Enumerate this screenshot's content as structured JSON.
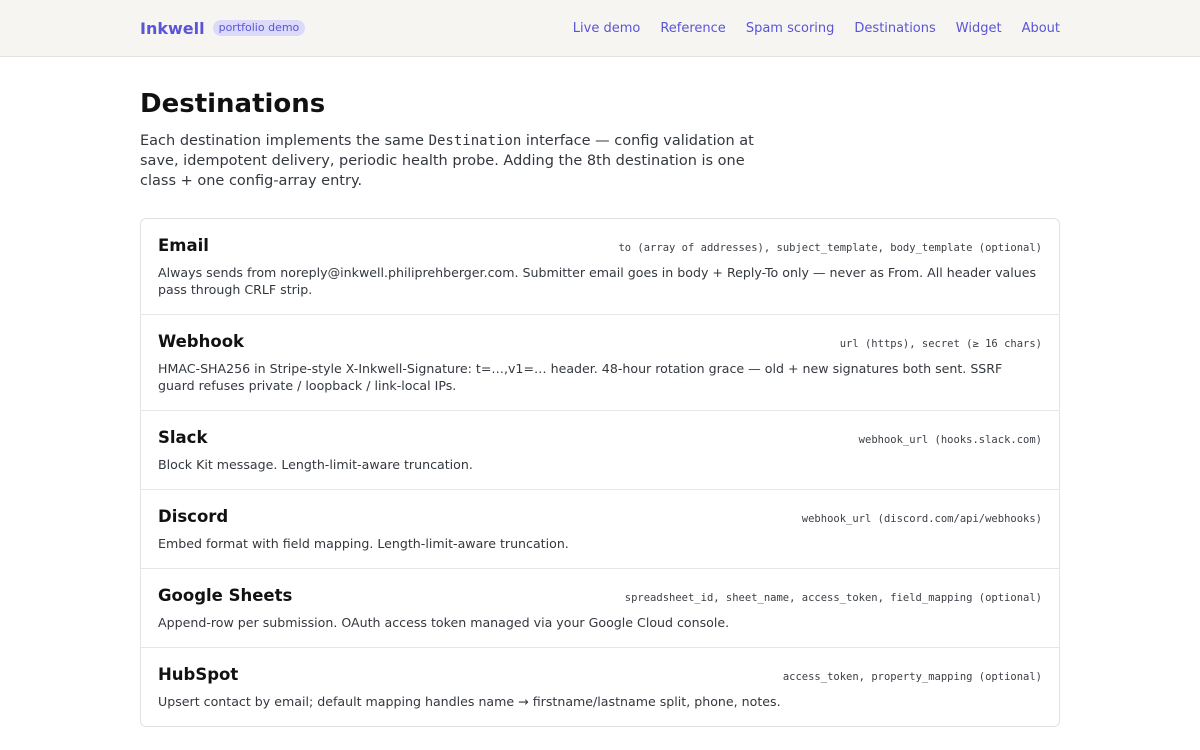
{
  "brand": {
    "name": "Inkwell",
    "badge": "portfolio demo"
  },
  "nav": [
    "Live demo",
    "Reference",
    "Spam scoring",
    "Destinations",
    "Widget",
    "About"
  ],
  "page": {
    "title": "Destinations",
    "intro_before": "Each destination implements the same ",
    "intro_code": "Destination",
    "intro_after": " interface — config validation at save, idempotent delivery, periodic health probe. Adding the 8th destination is one class + one config-array entry."
  },
  "destinations": [
    {
      "name": "Email",
      "config": "to (array of addresses), subject_template, body_template (optional)",
      "description": "Always sends from noreply@inkwell.philiprehberger.com. Submitter email goes in body + Reply-To only — never as From. All header values pass through CRLF strip."
    },
    {
      "name": "Webhook",
      "config": "url (https), secret (≥ 16 chars)",
      "description": "HMAC-SHA256 in Stripe-style X-Inkwell-Signature: t=…,v1=… header. 48-hour rotation grace — old + new signatures both sent. SSRF guard refuses private / loopback / link-local IPs."
    },
    {
      "name": "Slack",
      "config": "webhook_url (hooks.slack.com)",
      "description": "Block Kit message. Length-limit-aware truncation."
    },
    {
      "name": "Discord",
      "config": "webhook_url (discord.com/api/webhooks)",
      "description": "Embed format with field mapping. Length-limit-aware truncation."
    },
    {
      "name": "Google Sheets",
      "config": "spreadsheet_id, sheet_name, access_token, field_mapping (optional)",
      "description": "Append-row per submission. OAuth access token managed via your Google Cloud console."
    },
    {
      "name": "HubSpot",
      "config": "access_token, property_mapping (optional)",
      "description": "Upsert contact by email; default mapping handles name → firstname/lastname split, phone, notes."
    }
  ]
}
